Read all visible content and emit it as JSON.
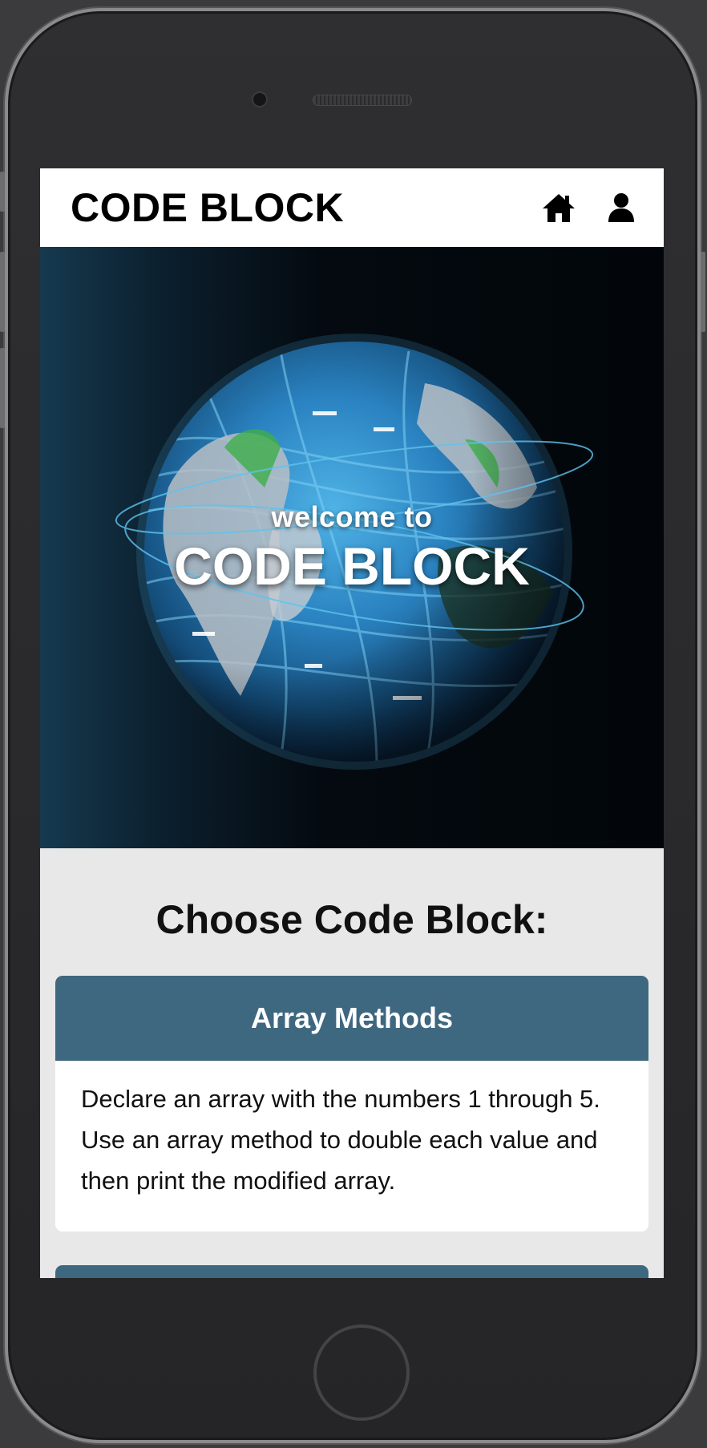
{
  "header": {
    "brand": "CODE BLOCK",
    "icons": [
      "home-icon",
      "user-icon"
    ]
  },
  "hero": {
    "welcome": "welcome to",
    "title": "CODE BLOCK"
  },
  "main": {
    "section_title": "Choose Code Block:",
    "cards": [
      {
        "title": "Array Methods",
        "description": "Declare an array with the numbers 1 through 5. Use an array method to double each value and then print the modified array."
      }
    ]
  },
  "colors": {
    "card_header": "#3e6780",
    "page_background": "#e8e8e8",
    "header_background": "#ffffff"
  }
}
